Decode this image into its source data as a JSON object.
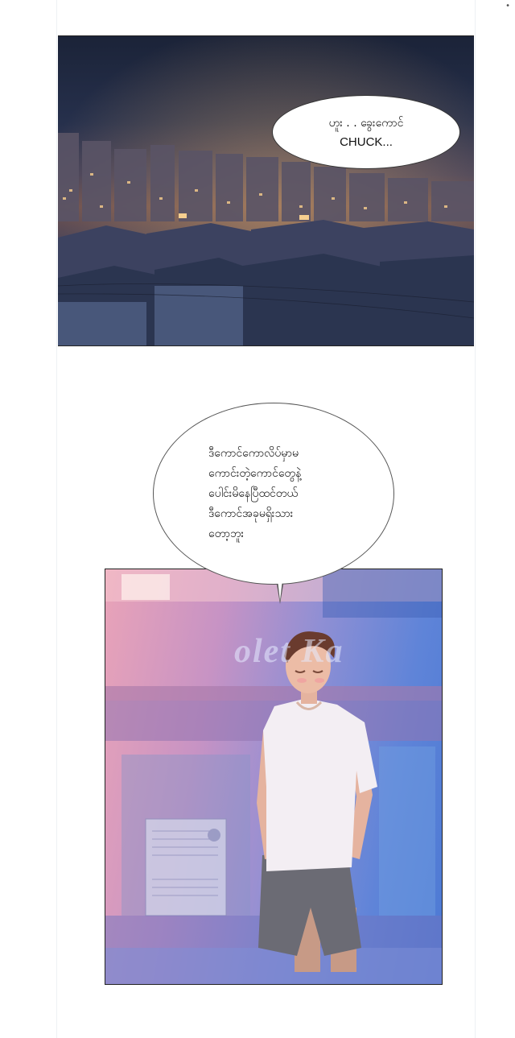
{
  "corner_mark": "•",
  "panel1": {
    "bubble": {
      "line1": "ဟူး . . ခွေးကောင်",
      "line2": "CHUCK..."
    }
  },
  "panel2": {
    "bubble": {
      "lines": [
        "ဒီကောင်ကောလိပ်မှာမ",
        "ကောင်းတဲ့ကောင်တွေနဲ့",
        "ပေါင်းမိနေပြီထင်တယ်",
        "ဒီကောင်အခုမရှိးသား",
        "တော့ဘူး"
      ]
    },
    "store_sign": "olet Ka"
  }
}
